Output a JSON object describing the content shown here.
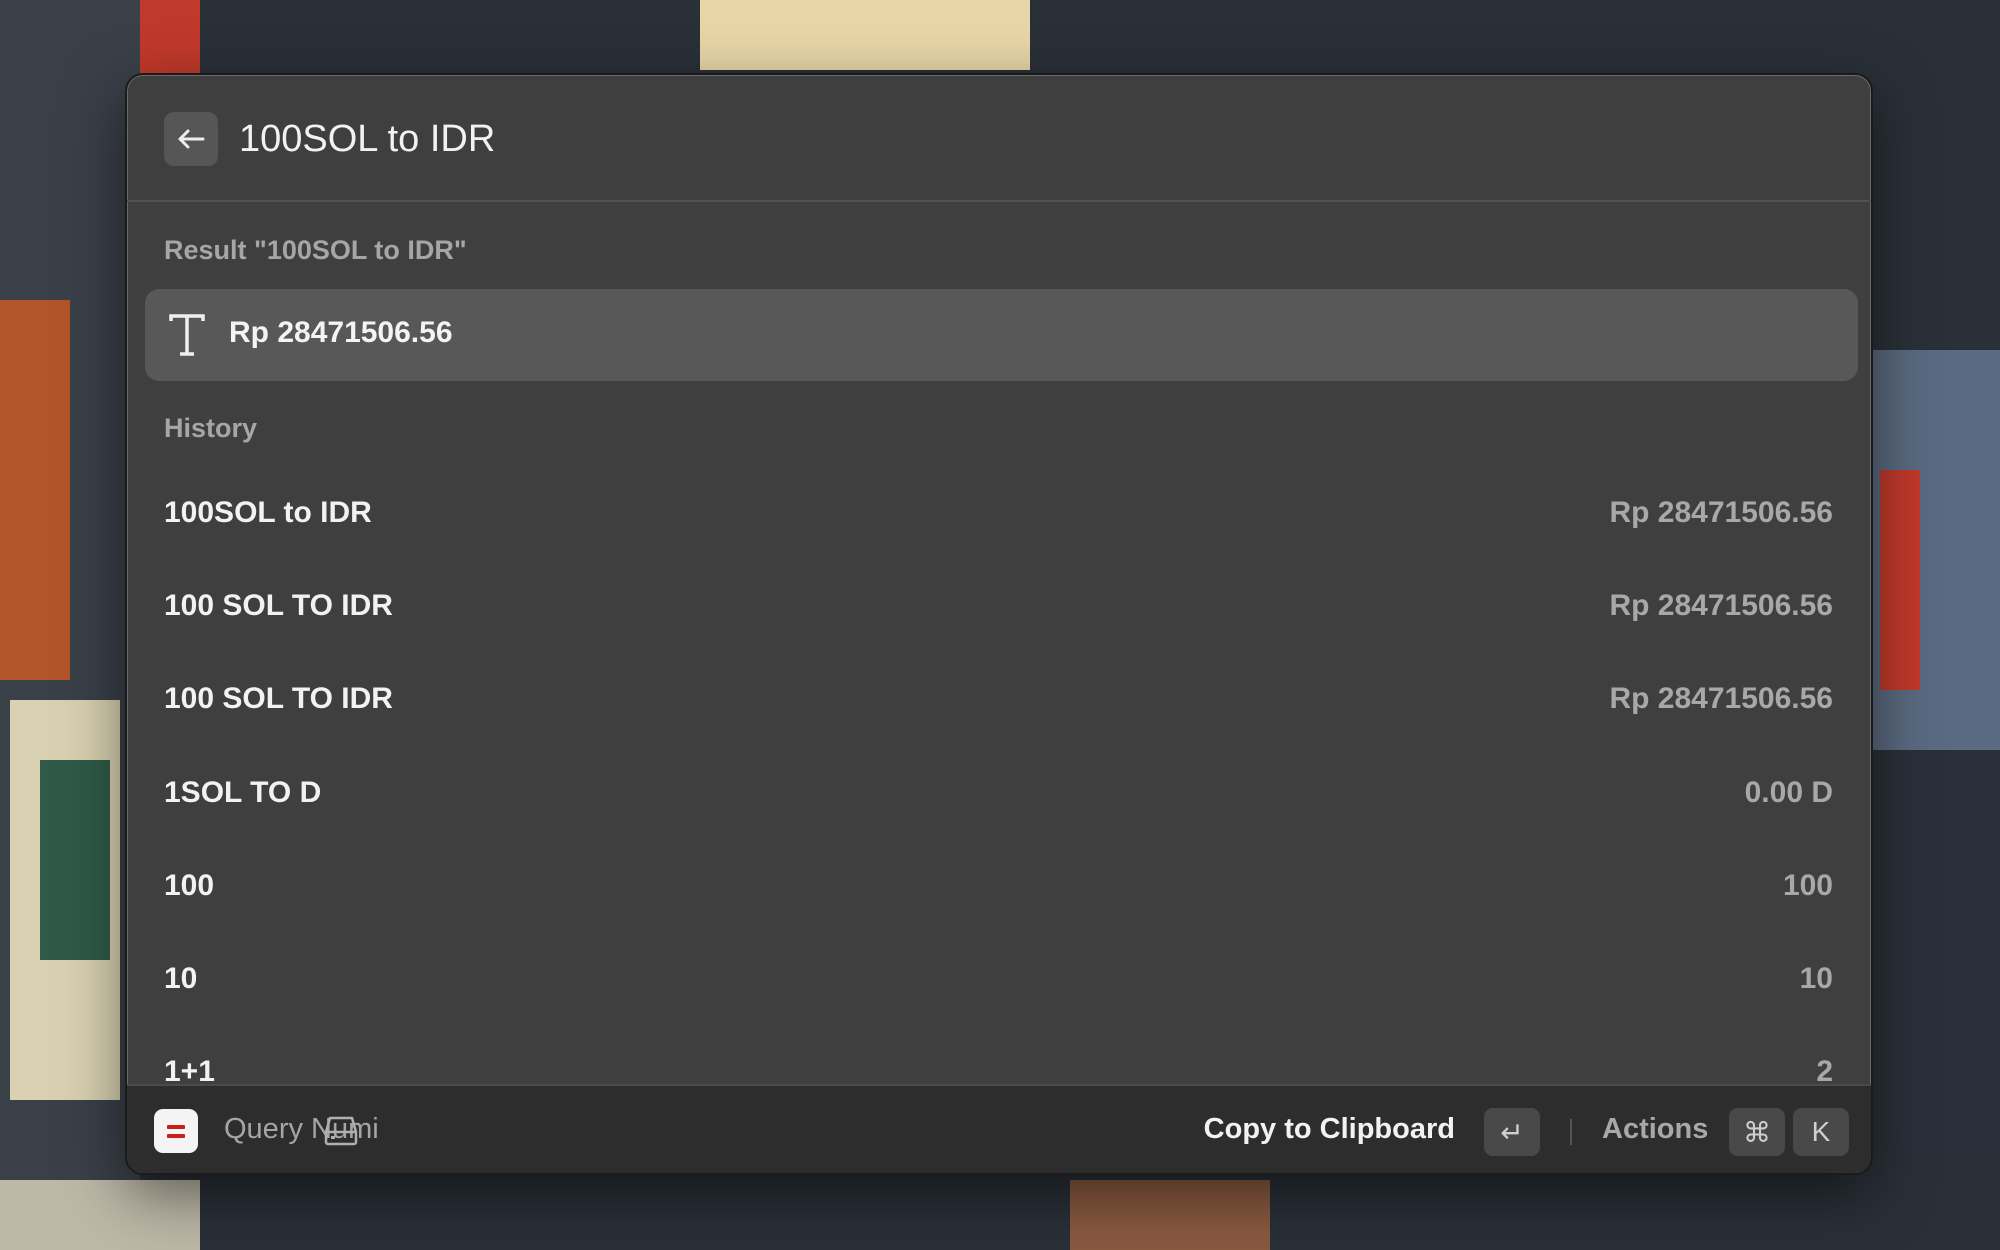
{
  "header": {
    "title": "100SOL to IDR",
    "back_icon": "arrow-left-icon"
  },
  "result": {
    "section_label": "Result \"100SOL to IDR\"",
    "icon": "text-t-icon",
    "value": "Rp 28471506.56"
  },
  "history": {
    "section_label": "History",
    "items": [
      {
        "query": "100SOL to IDR",
        "answer": "Rp 28471506.56"
      },
      {
        "query": "100 SOL TO IDR",
        "answer": "Rp 28471506.56"
      },
      {
        "query": "100 SOL TO IDR",
        "answer": "Rp 28471506.56"
      },
      {
        "query": "1SOL TO D",
        "answer": "0.00 D"
      },
      {
        "query": "100",
        "answer": "100"
      },
      {
        "query": "10",
        "answer": "10"
      },
      {
        "query": "1+1",
        "answer": "2"
      }
    ]
  },
  "footer": {
    "extension_name": "Query Numi",
    "primary_action": "Copy to Clipboard",
    "primary_key": "↵",
    "actions_label": "Actions",
    "actions_keys": [
      "⌘",
      "K"
    ]
  },
  "colors": {
    "window_bg": "#3f3f3f",
    "selected_bg": "#585858",
    "footer_bg": "#2d2d2d",
    "app_icon_accent": "#c81e1e"
  }
}
